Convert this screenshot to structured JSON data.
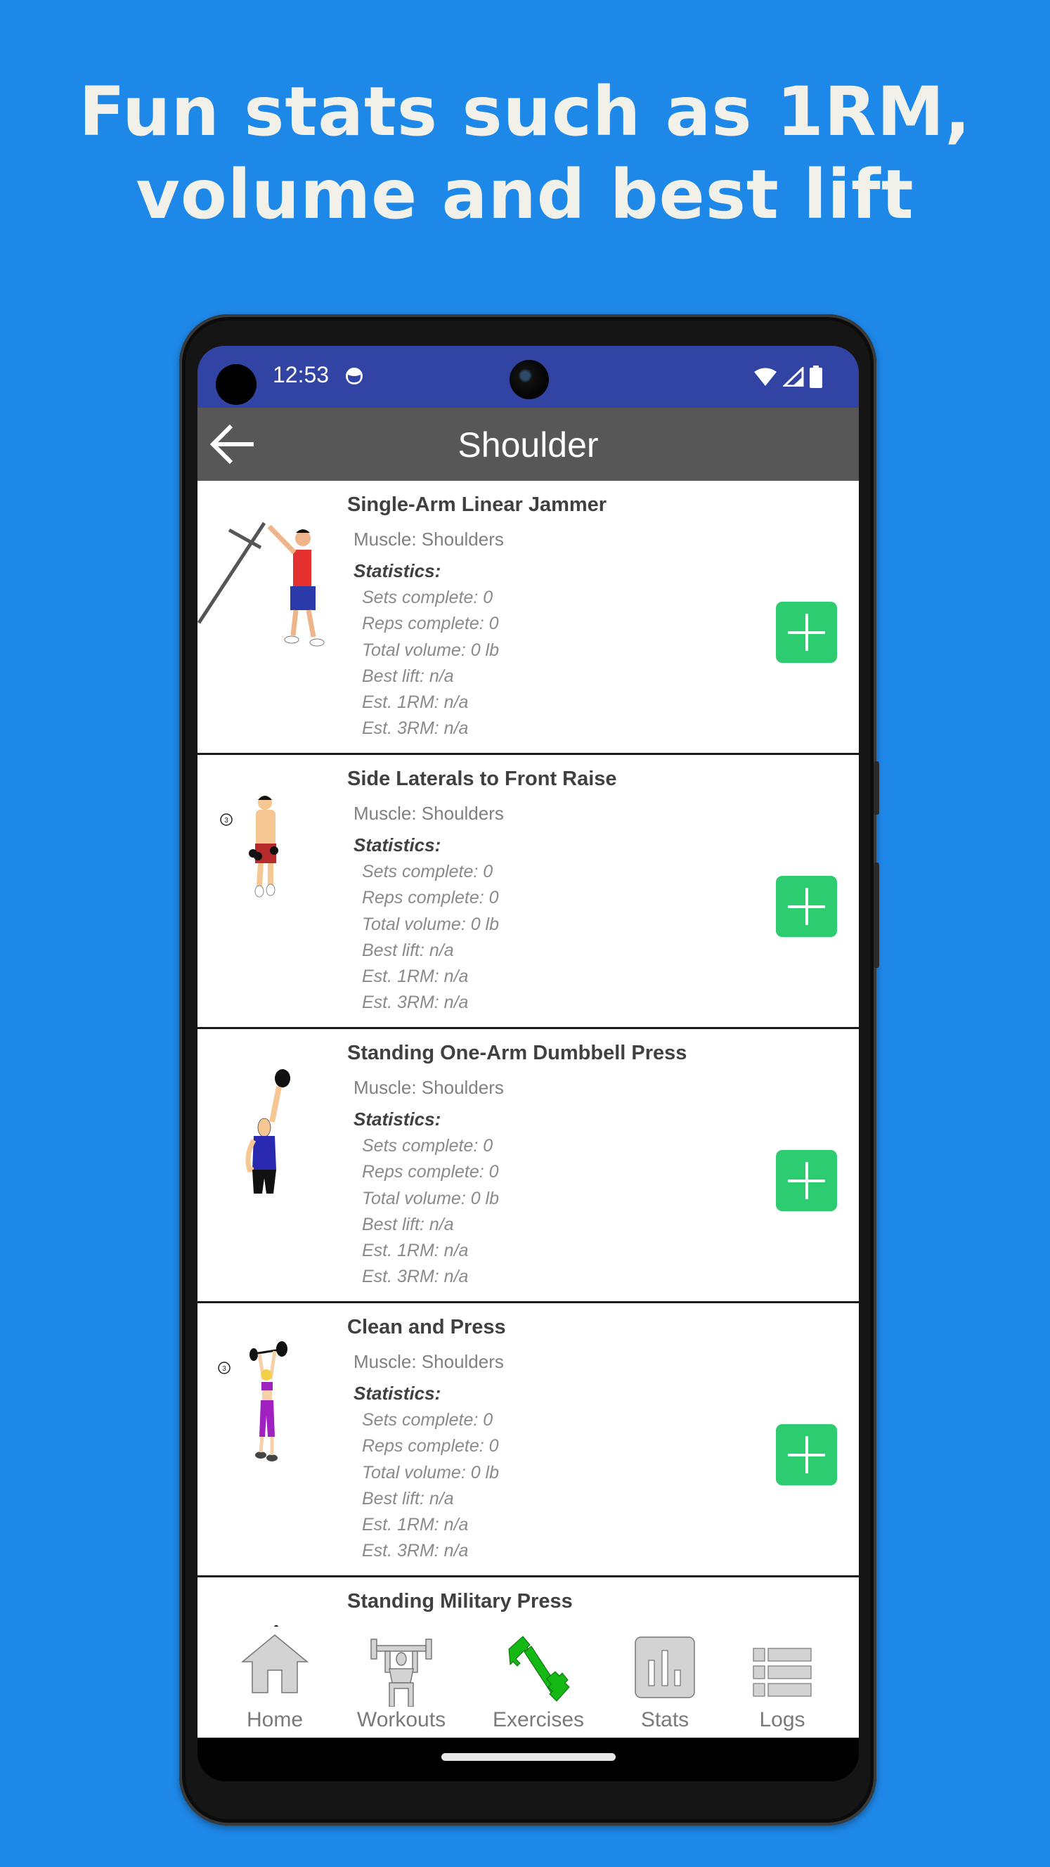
{
  "headline": {
    "line1": "Fun stats such as 1RM,",
    "line2": "volume and best lift"
  },
  "colors": {
    "background": "#1e88e8",
    "status_bar": "#3143a3",
    "app_bar": "#575757",
    "add_button": "#2ecc71",
    "active_nav": "#14b814"
  },
  "status_bar": {
    "time": "12:53",
    "icons": [
      "app-notification-icon",
      "wifi-icon",
      "cellular-signal-icon",
      "battery-icon"
    ]
  },
  "app_bar": {
    "back_icon": "arrow-left-icon",
    "title": "Shoulder"
  },
  "exercises": [
    {
      "name": "Single-Arm Linear Jammer",
      "muscle": "Muscle: Shoulders",
      "stats_heading": "Statistics:",
      "stats": [
        "Sets complete: 0",
        "Reps complete: 0",
        "Total volume: 0 lb",
        "Best lift: n/a",
        "Est. 1RM: n/a",
        "Est. 3RM: n/a"
      ],
      "illustration": "landmine-press-illustration"
    },
    {
      "name": "Side Laterals to Front Raise",
      "muscle": "Muscle: Shoulders",
      "stats_heading": "Statistics:",
      "stats": [
        "Sets complete: 0",
        "Reps complete: 0",
        "Total volume: 0 lb",
        "Best lift: n/a",
        "Est. 1RM: n/a",
        "Est. 3RM: n/a"
      ],
      "illustration": "dumbbell-raise-illustration",
      "step_badge": "3"
    },
    {
      "name": "Standing One-Arm Dumbbell Press",
      "muscle": "Muscle: Shoulders",
      "stats_heading": "Statistics:",
      "stats": [
        "Sets complete: 0",
        "Reps complete: 0",
        "Total volume: 0 lb",
        "Best lift: n/a",
        "Est. 1RM: n/a",
        "Est. 3RM: n/a"
      ],
      "illustration": "one-arm-press-illustration"
    },
    {
      "name": "Clean and Press",
      "muscle": "Muscle: Shoulders",
      "stats_heading": "Statistics:",
      "stats": [
        "Sets complete: 0",
        "Reps complete: 0",
        "Total volume: 0 lb",
        "Best lift: n/a",
        "Est. 1RM: n/a",
        "Est. 3RM: n/a"
      ],
      "illustration": "clean-and-press-illustration",
      "step_badge": "3"
    },
    {
      "name": "Standing Military Press",
      "illustration": "military-press-illustration"
    }
  ],
  "bottom_nav": {
    "active": "Exercises",
    "items": [
      {
        "label": "Home",
        "icon": "home-icon"
      },
      {
        "label": "Workouts",
        "icon": "weightlifter-icon"
      },
      {
        "label": "Exercises",
        "icon": "dumbbell-icon"
      },
      {
        "label": "Stats",
        "icon": "bar-chart-icon"
      },
      {
        "label": "Logs",
        "icon": "list-icon"
      }
    ]
  }
}
